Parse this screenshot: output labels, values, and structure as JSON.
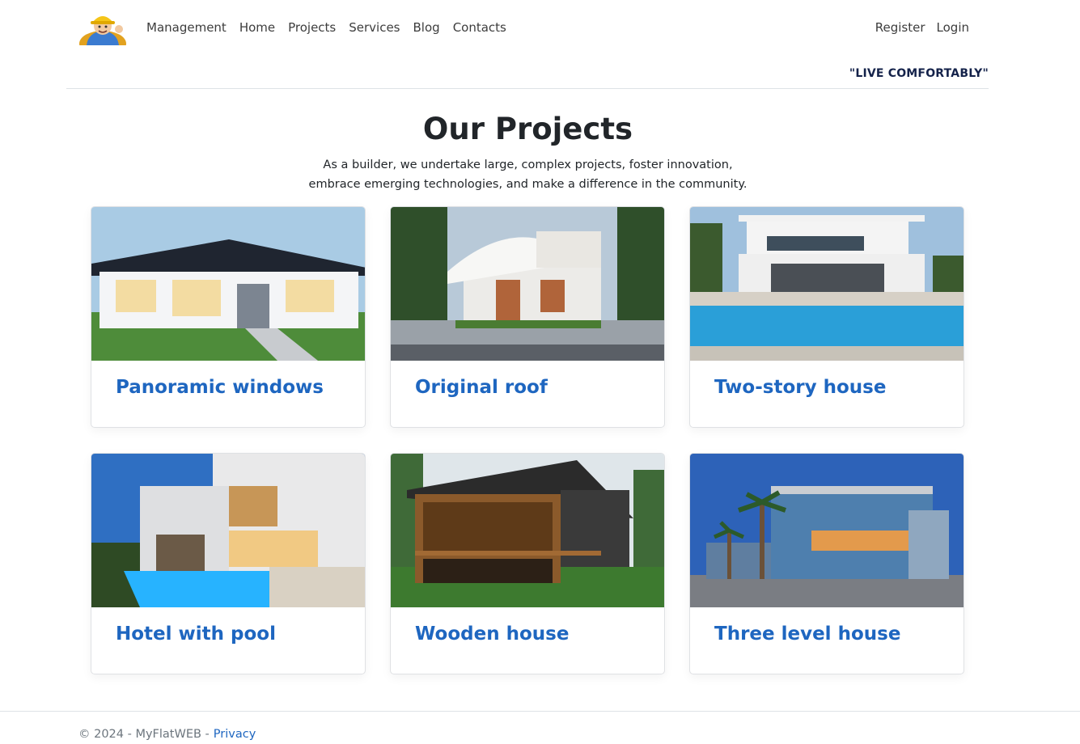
{
  "nav": {
    "left": [
      "Management",
      "Home",
      "Projects",
      "Services",
      "Blog",
      "Contacts"
    ],
    "right": [
      "Register",
      "Login"
    ],
    "slogan": "\"LIVE COMFORTABLY\""
  },
  "main": {
    "title": "Our Projects",
    "lead_line1": "As a builder, we undertake large, complex projects, foster innovation,",
    "lead_line2": "embrace emerging technologies, and make a difference in the community.",
    "cards": [
      {
        "title": "Panoramic windows"
      },
      {
        "title": "Original roof"
      },
      {
        "title": "Two-story house"
      },
      {
        "title": "Hotel with pool"
      },
      {
        "title": "Wooden house"
      },
      {
        "title": "Three level house"
      }
    ]
  },
  "footer": {
    "copyright": "© 2024 - MyFlatWEB -",
    "privacy": "Privacy"
  },
  "colors": {
    "link_blue": "#1e66c0",
    "slogan_navy": "#14224a",
    "border": "#dee2e6"
  }
}
